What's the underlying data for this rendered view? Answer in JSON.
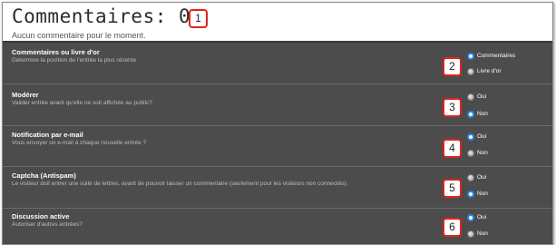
{
  "header": {
    "title": "Commentaires: 0",
    "subtitle": "Aucun commentaire pour le moment."
  },
  "callouts": [
    "1",
    "2",
    "3",
    "4",
    "5",
    "6"
  ],
  "sections": [
    {
      "title": "Commentaires ou livre d'or",
      "description": "Détermine la position de l'entrée la plus récente",
      "options": [
        {
          "label": "Commentaires",
          "selected": true
        },
        {
          "label": "Livre d'or",
          "selected": false
        }
      ]
    },
    {
      "title": "Modérer",
      "description": "Valider entrée avant qu'elle ne soit affichée au public?",
      "options": [
        {
          "label": "Oui",
          "selected": false
        },
        {
          "label": "Non",
          "selected": true
        }
      ]
    },
    {
      "title": "Notification par e-mail",
      "description": "Vous envoyer un e-mail à chaque nouvelle entrée ?",
      "options": [
        {
          "label": "Oui",
          "selected": true
        },
        {
          "label": "Non",
          "selected": false
        }
      ]
    },
    {
      "title": "Captcha (Antispam)",
      "description": "Le visiteur doit entrer une suite de lettres, avant de pouvoir laisser un commentaire (seulement pour les visiteurs non connectés).",
      "options": [
        {
          "label": "Oui",
          "selected": false
        },
        {
          "label": "Non",
          "selected": true
        }
      ]
    },
    {
      "title": "Discussion active",
      "description": "Autoriser d'autres entrées?",
      "options": [
        {
          "label": "Oui",
          "selected": true
        },
        {
          "label": "Non",
          "selected": false
        }
      ]
    }
  ],
  "colors": {
    "panel_bg": "#4c4c4c",
    "radio_selected": "#2a83e6",
    "callout_border": "#e2231a"
  }
}
